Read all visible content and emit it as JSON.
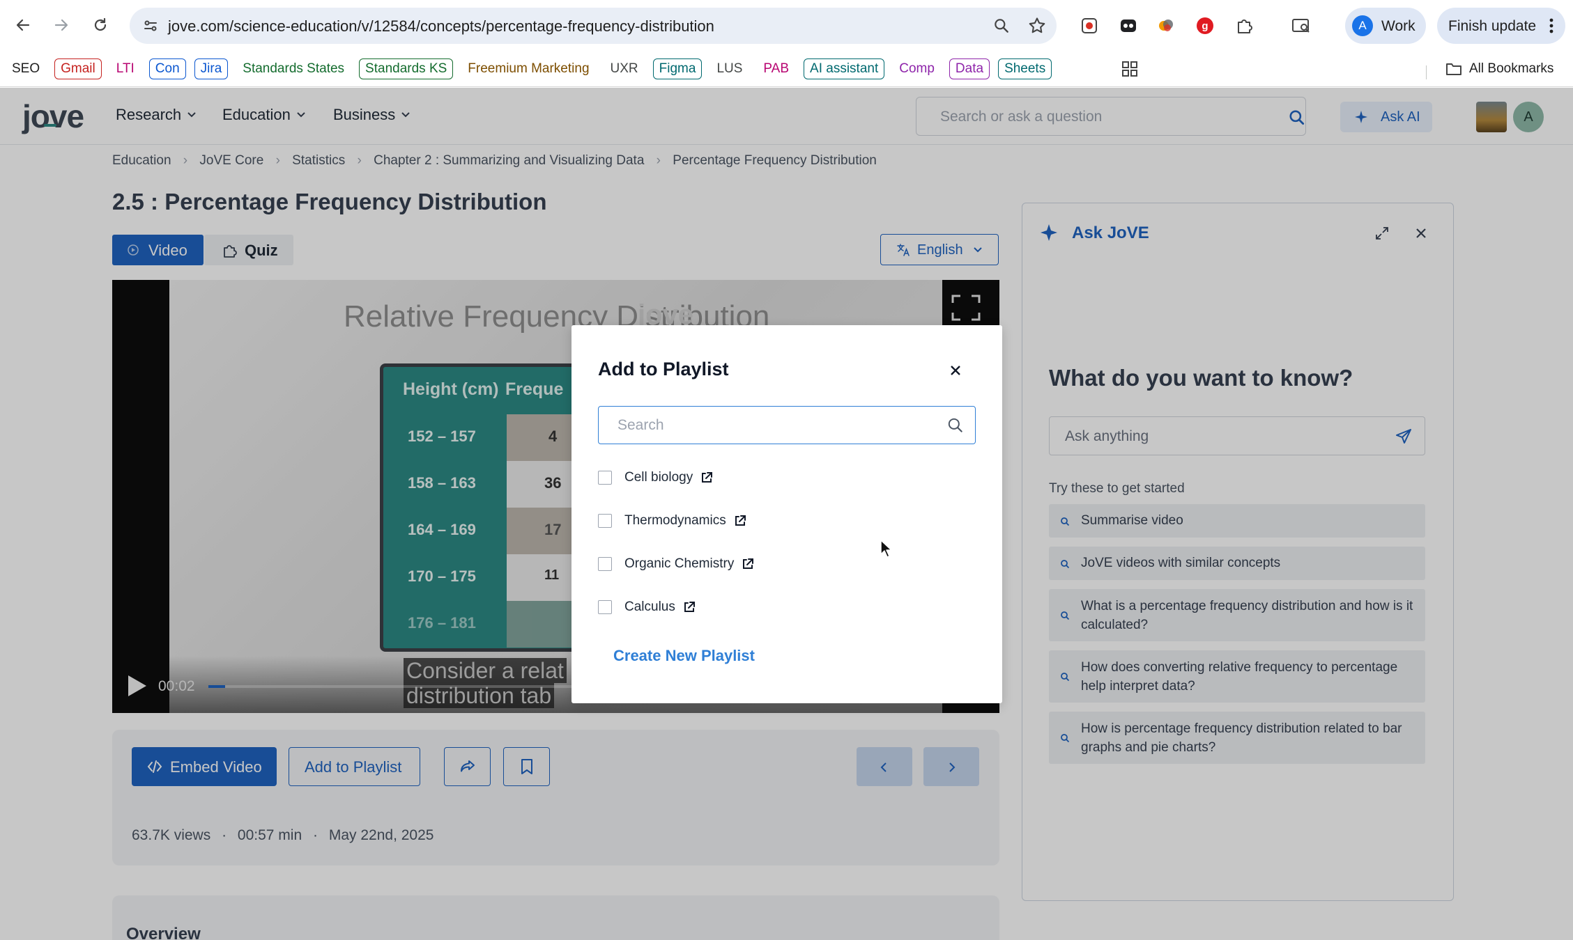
{
  "browser": {
    "url": "jove.com/science-education/v/12584/concepts/percentage-frequency-distribution",
    "profile_initial": "A",
    "profile_name": "Work",
    "finish_update": "Finish update",
    "bookmarks": [
      {
        "label": "SEO",
        "color": "#1f1f1f",
        "border": "transparent"
      },
      {
        "label": "Gmail",
        "color": "#c5221f",
        "border": "#c5221f"
      },
      {
        "label": "LTI",
        "color": "#b80672",
        "border": "transparent"
      },
      {
        "label": "Con",
        "color": "#0b57d0",
        "border": "#0b57d0"
      },
      {
        "label": "Jira",
        "color": "#0b57d0",
        "border": "#0b57d0"
      },
      {
        "label": "Standards States",
        "color": "#146c2e",
        "border": "transparent"
      },
      {
        "label": "Standards KS",
        "color": "#146c2e",
        "border": "#146c2e"
      },
      {
        "label": "Freemium Marketing",
        "color": "#7d4e00",
        "border": "transparent"
      },
      {
        "label": "UXR",
        "color": "#444746",
        "border": "transparent"
      },
      {
        "label": "Figma",
        "color": "#00696f",
        "border": "#00696f"
      },
      {
        "label": "LUS",
        "color": "#444746",
        "border": "transparent"
      },
      {
        "label": "PAB",
        "color": "#b80672",
        "border": "transparent"
      },
      {
        "label": "AI assistant",
        "color": "#00696f",
        "border": "#00696f"
      },
      {
        "label": "Comp",
        "color": "#8e24aa",
        "border": "transparent"
      },
      {
        "label": "Data",
        "color": "#8e24aa",
        "border": "#8e24aa"
      },
      {
        "label": "Sheets",
        "color": "#00696f",
        "border": "#00696f"
      }
    ],
    "all_bookmarks": "All Bookmarks"
  },
  "site": {
    "logo": "jove",
    "menu": [
      "Research",
      "Education",
      "Business"
    ],
    "search_placeholder": "Search or ask a question",
    "ask_ai": "Ask AI",
    "user_initial": "A"
  },
  "breadcrumb": [
    "Education",
    "JoVE Core",
    "Statistics",
    "Chapter 2 : Summarizing and Visualizing Data",
    "Percentage Frequency Distribution"
  ],
  "page_title": "2.5 : Percentage Frequency Distribution",
  "tabs": {
    "video": "Video",
    "quiz": "Quiz"
  },
  "language": "English",
  "video": {
    "slide_title": "Relative Frequency Distribution",
    "watermark": "jove",
    "table_header": [
      "Height (cm)",
      "Freque"
    ],
    "rows": [
      {
        "range": "152 – 157",
        "freq": "4"
      },
      {
        "range": "158 – 163",
        "freq": "36"
      },
      {
        "range": "164 – 169",
        "freq": "17"
      },
      {
        "range": "170 – 175",
        "freq": "11"
      },
      {
        "range": "176 – 181",
        "freq": ""
      }
    ],
    "caption_line1": "Consider a relat",
    "caption_line2": "distribution tab",
    "time": "00:02",
    "progress": 0.01
  },
  "actions": {
    "embed": "Embed Video",
    "add_playlist": "Add to Playlist",
    "views": "63.7K views",
    "duration": "00:57 min",
    "date": "May 22nd, 2025",
    "sep": "·"
  },
  "bottom_heading": "Overview",
  "ask_panel": {
    "title": "Ask JoVE",
    "heading": "What do you want to know?",
    "input_placeholder": "Ask anything",
    "try_label": "Try these to get started",
    "suggestions": [
      "Summarise video",
      "JoVE videos with similar concepts",
      "What is a percentage frequency distribution and how is it calculated?",
      "How does converting relative frequency to percentage help interpret data?",
      "How is percentage frequency distribution related to bar graphs and pie charts?"
    ]
  },
  "modal": {
    "title": "Add to Playlist",
    "search_placeholder": "Search",
    "playlists": [
      "Cell biology",
      "Thermodynamics",
      "Organic Chemistry",
      "Calculus"
    ],
    "create": "Create New Playlist"
  },
  "colors": {
    "primary": "#1f63c0",
    "teal": "#2c8a84",
    "link": "#2f7fd6"
  }
}
